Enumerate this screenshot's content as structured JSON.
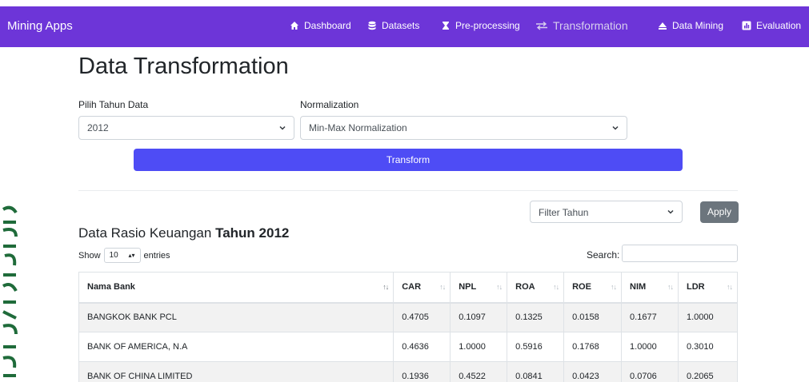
{
  "navbar": {
    "brand": "Mining Apps",
    "items": [
      {
        "label": "Dashboard",
        "icon": "home-icon"
      },
      {
        "label": "Datasets",
        "icon": "database-icon"
      },
      {
        "label": "Pre-processing",
        "icon": "hourglass-icon"
      },
      {
        "label": "Transformation",
        "icon": "exchange-arrows-icon",
        "active": true
      },
      {
        "label": "Data Mining",
        "icon": "eject-icon"
      },
      {
        "label": "Evaluation",
        "icon": "chart-square-icon"
      }
    ],
    "bg_color": "#6d35d8"
  },
  "page": {
    "title": "Data Transformation"
  },
  "form": {
    "year_label": "Pilih Tahun Data",
    "year_value": "2012",
    "norm_label": "Normalization",
    "norm_value": "Min-Max Normalization",
    "transform_button": "Transform"
  },
  "filter": {
    "select_value": "Filter Tahun",
    "apply_button": "Apply"
  },
  "section": {
    "title_prefix": "Data Rasio Keuangan",
    "title_bold": "Tahun 2012"
  },
  "datatable": {
    "show_label": "Show",
    "length_value": "10",
    "entries_label": "entries",
    "search_label": "Search:",
    "columns": [
      "Nama Bank",
      "CAR",
      "NPL",
      "ROA",
      "ROE",
      "NIM",
      "LDR"
    ],
    "rows": [
      [
        "BANGKOK BANK PCL",
        "0.4705",
        "0.1097",
        "0.1325",
        "0.0158",
        "0.1677",
        "1.0000"
      ],
      [
        "BANK OF AMERICA, N.A",
        "0.4636",
        "1.0000",
        "0.5916",
        "0.1768",
        "1.0000",
        "0.3010"
      ],
      [
        "BANK OF CHINA LIMITED",
        "0.1936",
        "0.4522",
        "0.0841",
        "0.0423",
        "0.0706",
        "0.2065"
      ]
    ]
  }
}
